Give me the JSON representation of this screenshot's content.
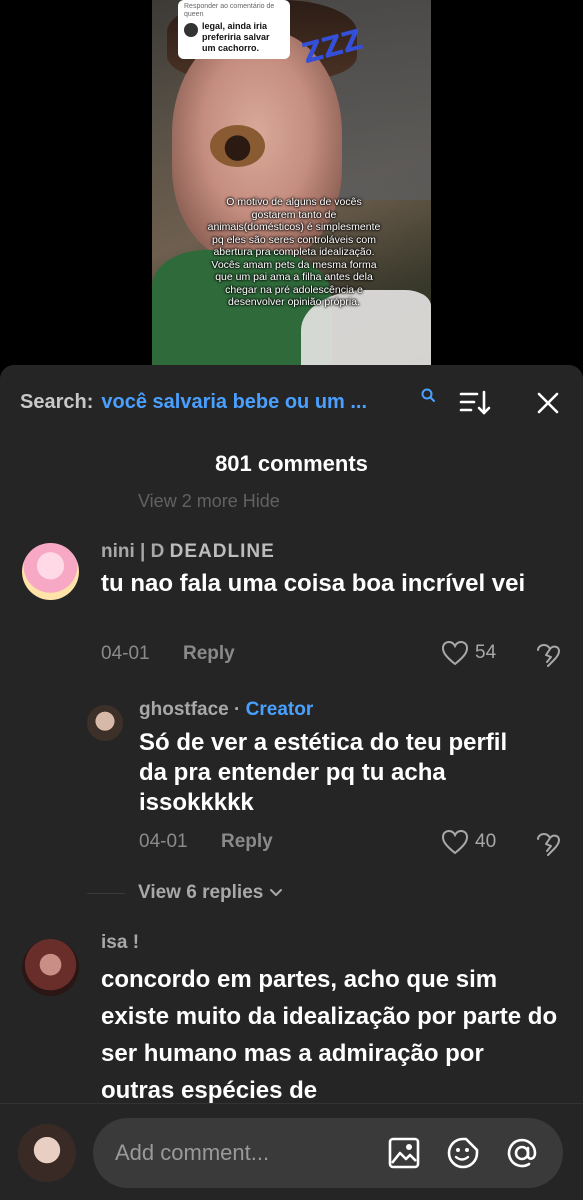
{
  "video": {
    "reply_bubble": {
      "top_line_1": "Responder ao comentário de",
      "top_line_2": "queen",
      "text": "legal, ainda iria preferiria salvar um cachorro."
    },
    "sticker_text": "ZZZ",
    "overlay_text": "O motivo de alguns de vocês gostarem tanto de animais(domésticos) é simplesmente pq eles são seres controláveis com abertura pra completa idealização. Vocês amam pets da mesma forma que um pai ama a filha antes dela chegar na pré adolescência e desenvolver opinião própria."
  },
  "sheet": {
    "search_label": "Search:",
    "search_query": "você salvaria bebe ou um ...",
    "comment_count": "801 comments",
    "ghost_text": "View 2 more     Hide",
    "comments": [
      {
        "username": "nini | D",
        "username_logo": "DEADLINE",
        "text": "tu nao fala uma coisa boa incrível vei",
        "date": "04-01",
        "reply_label": "Reply",
        "likes": "54"
      },
      {
        "username": "ghostface",
        "creator_sep": "·",
        "creator_label": "Creator",
        "text": "Só de ver a estética do teu perfil da pra entender pq tu acha issokkkkk",
        "date": "04-01",
        "reply_label": "Reply",
        "likes": "40"
      },
      {
        "username": "isa !",
        "text": "concordo em partes, acho que sim existe muito da idealização por parte do ser humano mas a admiração por outras espécies de"
      }
    ],
    "view_replies": "View 6 replies"
  },
  "composer": {
    "placeholder": "Add comment..."
  },
  "colors": {
    "accent": "#4aa0ff",
    "sheet_bg": "#252525",
    "text_muted": "#8a8a8a"
  }
}
